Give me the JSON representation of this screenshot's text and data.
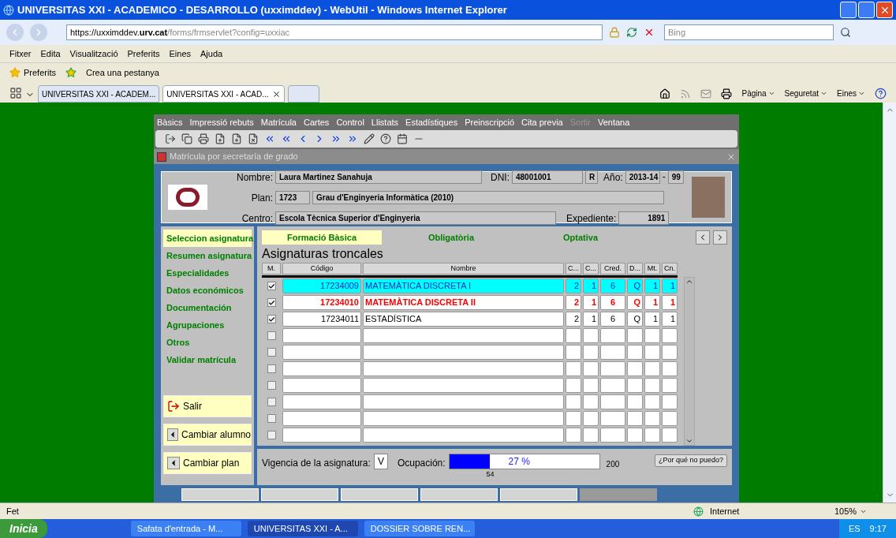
{
  "browser": {
    "title": "UNIVERSITAS XXI - ACADEMICO - DESARROLLO (uxximddev) - WebUtil - Windows Internet Explorer",
    "address_prefix": "https://uxximddev.",
    "address_domain": "urv.cat",
    "address_path": "/forms/frmservlet?config=uxxiac",
    "search_placeholder": "Bing",
    "menu": [
      "Fitxer",
      "Edita",
      "Visualització",
      "Preferits",
      "Eines",
      "Ajuda"
    ],
    "favorites": [
      "Preferits",
      "Crea una pestanya"
    ],
    "tabs": [
      {
        "label": "UNIVERSITAS XXI - ACADEM...",
        "selected": false
      },
      {
        "label": "UNIVERSITAS XXI - ACAD...",
        "selected": true
      }
    ],
    "commands": [
      "Pàgina",
      "Seguretat",
      "Eines"
    ]
  },
  "app": {
    "menu": [
      {
        "label": "Bàsics",
        "disabled": false
      },
      {
        "label": "Impressió rebuts",
        "disabled": false
      },
      {
        "label": "Matrícula",
        "disabled": false
      },
      {
        "label": "Cartes",
        "disabled": false
      },
      {
        "label": "Control",
        "disabled": false
      },
      {
        "label": "Llistats",
        "disabled": false
      },
      {
        "label": "Estadístiques",
        "disabled": false
      },
      {
        "label": "Preinscripció",
        "disabled": false
      },
      {
        "label": "Cita previa",
        "disabled": false
      },
      {
        "label": "Sortir",
        "disabled": true
      },
      {
        "label": "Ventana",
        "disabled": false
      }
    ],
    "window_title": "Matrícula por secretaría de grado",
    "student": {
      "nombre_label": "Nombre:",
      "nombre": "Laura Martinez Sanahuja",
      "dni_label": "DNI:",
      "dni": "48001001",
      "dni_flag": "R",
      "ano_label": "Año:",
      "ano": "2013-14",
      "ano_sep": "-",
      "ano_code": "99",
      "plan_label": "Plan:",
      "plan_code": "1723",
      "plan_name": "Grau d'Enginyeria Informàtica (2010)",
      "centro_label": "Centro:",
      "centro": "Escola Tècnica Superior d'Enginyeria",
      "expediente_label": "Expediente:",
      "expediente": "1891"
    },
    "side_nav": [
      {
        "label": "Seleccion asignatura",
        "selected": true
      },
      {
        "label": "Resumen asignatura",
        "selected": false
      },
      {
        "label": "Especialidades",
        "selected": false
      },
      {
        "label": "Datos económicos",
        "selected": false
      },
      {
        "label": "Documentación",
        "selected": false
      },
      {
        "label": "Agrupaciones",
        "selected": false
      },
      {
        "label": "Otros",
        "selected": false
      },
      {
        "label": "Validar matrícula",
        "selected": false
      }
    ],
    "side_buttons": [
      {
        "kind": "exit",
        "label": "Salir"
      },
      {
        "kind": "back",
        "label": "Cambiar alumno"
      },
      {
        "kind": "back",
        "label": "Cambiar plan"
      }
    ],
    "tabs": [
      {
        "label": "Formació Bàsica",
        "selected": true
      },
      {
        "label": "Obligatòria",
        "selected": false
      },
      {
        "label": "Optativa",
        "selected": false
      }
    ],
    "section_title": "Asignaturas troncales",
    "columns": [
      "M.",
      "Código",
      "Nombre",
      "C...",
      "C...",
      "Cred.",
      "D...",
      "Mt.",
      "Cn."
    ],
    "rows": [
      {
        "checked": true,
        "kind": "current",
        "cells": [
          "17234009",
          "MATEMÀTICA DISCRETA I",
          "2",
          "1",
          "6",
          "Q",
          "1",
          "1"
        ]
      },
      {
        "checked": true,
        "kind": "error",
        "cells": [
          "17234010",
          "MATEMÀTICA DISCRETA II",
          "2",
          "1",
          "6",
          "Q",
          "1",
          "1"
        ]
      },
      {
        "checked": true,
        "kind": "normal",
        "cells": [
          "17234011",
          "ESTADÍSTICA",
          "2",
          "1",
          "6",
          "Q",
          "1",
          "1"
        ]
      },
      {
        "checked": false,
        "kind": "normal"
      },
      {
        "checked": false,
        "kind": "normal"
      },
      {
        "checked": false,
        "kind": "normal"
      },
      {
        "checked": false,
        "kind": "normal"
      },
      {
        "checked": false,
        "kind": "normal"
      },
      {
        "checked": false,
        "kind": "normal"
      },
      {
        "checked": false,
        "kind": "normal"
      }
    ],
    "footer": {
      "vigencia_label": "Vigencia de la asignatura:",
      "vigencia": "V",
      "ocupacion_label": "Ocupación:",
      "level": 0.27,
      "percent": "27 %",
      "max": "200",
      "current": "54",
      "why_button": "¿Por qué no puedo?"
    },
    "bottom_buttons": [
      {
        "disabled": false
      },
      {
        "disabled": false
      },
      {
        "disabled": false
      },
      {
        "disabled": false
      },
      {
        "disabled": false
      },
      {
        "disabled": true
      }
    ]
  },
  "status_bar": {
    "text": "Fet",
    "zone": "Internet",
    "zoom": "105%"
  },
  "taskbar": {
    "start": "Inicia",
    "tasks": [
      {
        "label": "Safata d'entrada - M...",
        "selected": false
      },
      {
        "label": "UNIVERSITAS XXI - A...",
        "selected": true
      },
      {
        "label": "DOSSIER SOBRE REN...",
        "selected": false
      }
    ],
    "lang": "ES",
    "clock": "9:17"
  }
}
